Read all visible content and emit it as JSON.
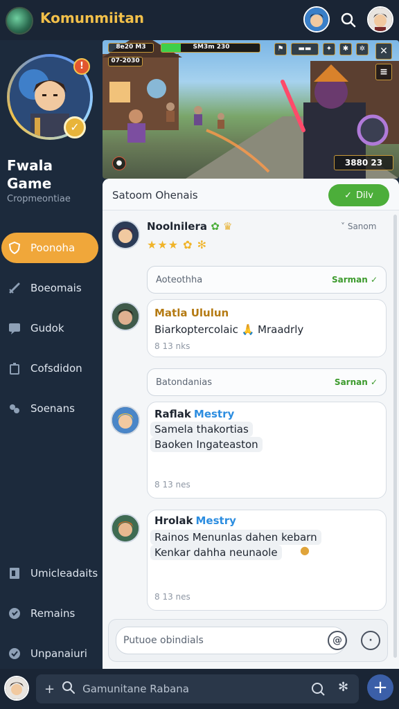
{
  "header": {
    "title": "Komunmiitan"
  },
  "sidebar": {
    "notification_count": "!",
    "title": "Fwala Game",
    "subtitle": "Cropmeontiae",
    "items": [
      {
        "label": "Poonoha",
        "icon": "shield-icon",
        "active": true
      },
      {
        "label": "Boeomais",
        "icon": "sword-icon",
        "active": false
      },
      {
        "label": "Gudok",
        "icon": "chat-icon",
        "active": false
      },
      {
        "label": "Cofsdidon",
        "icon": "cup-icon",
        "active": false
      },
      {
        "label": "Soenans",
        "icon": "gamepad-icon",
        "active": false
      },
      {
        "label": "Umicleadaits",
        "icon": "document-icon",
        "active": false
      },
      {
        "label": "Remains",
        "icon": "heart-icon",
        "active": false
      },
      {
        "label": "Unpanaiuri",
        "icon": "check-circle-icon",
        "active": false
      }
    ]
  },
  "banner": {
    "hud_left": "8e20 M3",
    "hud_health": "SM3m 230",
    "hud_health_fraction": 0.2,
    "hud_score": "07-2030",
    "hud_bottom_right": "3880 23"
  },
  "panel": {
    "title": "Satoom Ohenais",
    "join_label": "Dilv",
    "first": {
      "name": "Noolnilera",
      "right_label": "Sanom",
      "stars": "★★★ ✿ ✻"
    },
    "sys1": {
      "left": "Aoteothha",
      "right": "Sarman"
    },
    "msg1": {
      "name": "Matla Ululun",
      "text": "Biarkoptercolaic 🙏 Mraadrly",
      "time": "8 13 nks"
    },
    "sys2": {
      "left": "Batondanias",
      "right": "Sarnan"
    },
    "msg2": {
      "name": "Raflak",
      "name_tag": "Mestry",
      "line1": "Samela thakortias",
      "line2": "Baoken Ingateaston",
      "time": "8 13 nes"
    },
    "msg3": {
      "name": "Hrolak",
      "name_tag": "Mestry",
      "line1": "Rainos Menunlas dahen kebarn",
      "line2": "Kenkar dahha neunaole",
      "time": "8 13 nes"
    },
    "composer_placeholder": "Putuoe obindials"
  },
  "bottom": {
    "search_placeholder": "Gamunitane Rabana"
  },
  "colors": {
    "accent": "#f0a73a",
    "join": "#4cae3a",
    "link": "#2c8de0",
    "sidebar": "#1c2a3c"
  }
}
